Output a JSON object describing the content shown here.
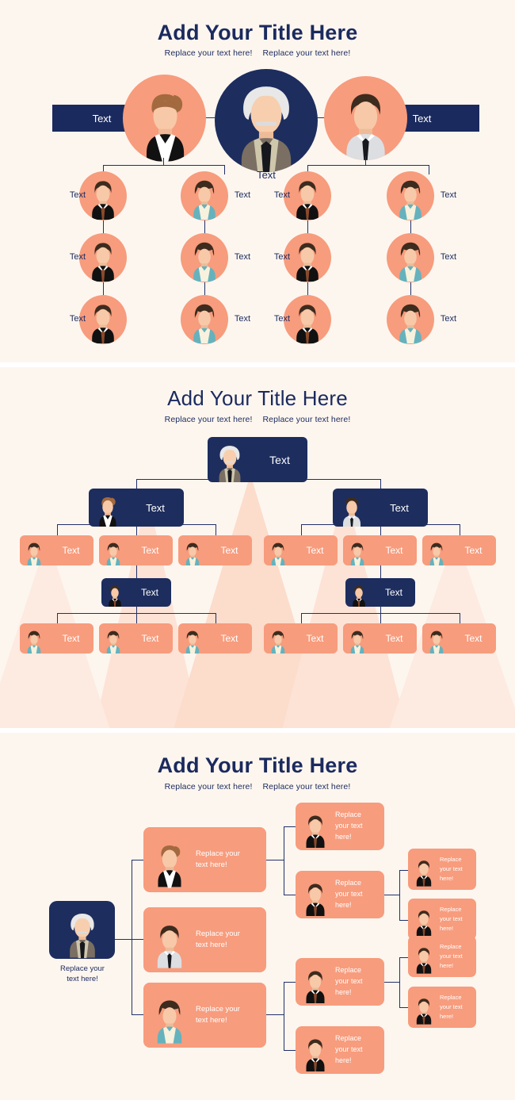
{
  "colors": {
    "background": "#fdf6ef",
    "navy": "#1d2d5e",
    "peach": "#f79c7d",
    "line": "#22306a",
    "title": "#1b2a5e",
    "triangle": "#fde2d5",
    "white": "#ffffff"
  },
  "sections": [
    {
      "id": "org-chart-circles",
      "title": "Add Your Title Here",
      "subtitle_left": "Replace your text here!",
      "subtitle_right": "Replace your text here!",
      "root": {
        "label": "Text",
        "avatar": "elder-man"
      },
      "side_boxes": [
        {
          "label": "Text",
          "side": "left"
        },
        {
          "label": "Text",
          "side": "right"
        }
      ],
      "branch_heads": [
        {
          "avatar": "woman-updo-black"
        },
        {
          "avatar": "man-grey-shirt"
        }
      ],
      "columns": [
        {
          "label_side": "left",
          "labels": [
            "Text",
            "Text",
            "Text"
          ],
          "avatar": "man-black-suit"
        },
        {
          "label_side": "right",
          "labels": [
            "Text",
            "Text",
            "Text"
          ],
          "avatar": "woman-teal"
        },
        {
          "label_side": "left",
          "labels": [
            "Text",
            "Text",
            "Text"
          ],
          "avatar": "man-black-suit"
        },
        {
          "label_side": "right",
          "labels": [
            "Text",
            "Text",
            "Text"
          ],
          "avatar": "woman-teal"
        }
      ]
    },
    {
      "id": "org-chart-boxes",
      "title": "Add Your Title Here",
      "subtitle_left": "Replace your text here!",
      "subtitle_right": "Replace your text here!",
      "root": {
        "label": "Text",
        "avatar": "elder-man"
      },
      "level2": [
        {
          "label": "Text",
          "avatar": "woman-updo-black"
        },
        {
          "label": "Text",
          "avatar": "man-grey-shirt"
        }
      ],
      "level3_left": [
        {
          "label": "Text"
        },
        {
          "label": "Text"
        },
        {
          "label": "Text"
        }
      ],
      "level3_right": [
        {
          "label": "Text"
        },
        {
          "label": "Text"
        },
        {
          "label": "Text"
        }
      ],
      "level4": [
        {
          "label": "Text",
          "avatar": "man-black-suit"
        },
        {
          "label": "Text",
          "avatar": "man-black-suit"
        }
      ],
      "level5_left": [
        {
          "label": "Text"
        },
        {
          "label": "Text"
        },
        {
          "label": "Text"
        }
      ],
      "level5_right": [
        {
          "label": "Text"
        },
        {
          "label": "Text"
        },
        {
          "label": "Text"
        }
      ]
    },
    {
      "id": "org-chart-tree",
      "title": "Add Your Title Here",
      "subtitle_left": "Replace your text here!",
      "subtitle_right": "Replace your text here!",
      "root": {
        "caption": "Replace your\ntext here!",
        "avatar": "elder-man"
      },
      "col2": [
        {
          "label": "Replace your\ntext here!",
          "avatar": "woman-updo-black"
        },
        {
          "label": "Replace your\ntext here!",
          "avatar": "man-grey-shirt"
        },
        {
          "label": "Replace your\ntext here!",
          "avatar": "woman-teal"
        }
      ],
      "col3": [
        {
          "label": "Replace\nyour text\nhere!",
          "avatar": "man-black-suit"
        },
        {
          "label": "Replace\nyour text\nhere!",
          "avatar": "man-black-suit"
        },
        {
          "label": "Replace\nyour text\nhere!",
          "avatar": "man-black-suit"
        },
        {
          "label": "Replace\nyour text\nhere!",
          "avatar": "man-black-suit"
        }
      ],
      "col4": [
        {
          "label": "Replace\nyour text\nhere!",
          "avatar": "man-black-suit"
        },
        {
          "label": "Replace\nyour text\nhere!",
          "avatar": "man-black-suit"
        },
        {
          "label": "Replace\nyour text\nhere!",
          "avatar": "man-black-suit"
        },
        {
          "label": "Replace\nyour text\nhere!",
          "avatar": "man-black-suit"
        }
      ]
    }
  ]
}
